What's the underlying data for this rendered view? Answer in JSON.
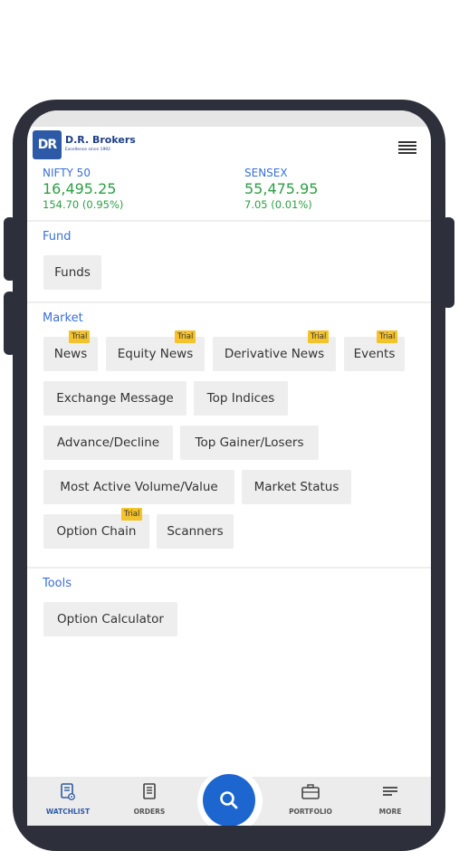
{
  "brand": {
    "logo_mark": "DR",
    "name": "D.R. Brokers",
    "tagline": "Excellence since 1992"
  },
  "indices": [
    {
      "name": "NIFTY 50",
      "value": "16,495.25",
      "change": "154.70 (0.95%)"
    },
    {
      "name": "SENSEX",
      "value": "55,475.95",
      "change": "7.05 (0.01%)"
    }
  ],
  "fund": {
    "title": "Fund",
    "items": [
      {
        "label": "Funds"
      }
    ]
  },
  "market": {
    "title": "Market",
    "badge_label": "Trial",
    "items": [
      {
        "label": "News",
        "trial": true
      },
      {
        "label": "Equity News",
        "trial": true
      },
      {
        "label": "Derivative News",
        "trial": true
      },
      {
        "label": "Events",
        "trial": true
      },
      {
        "label": "Exchange Message",
        "trial": false
      },
      {
        "label": "Top Indices",
        "trial": false
      },
      {
        "label": "Advance/Decline",
        "trial": false
      },
      {
        "label": "Top Gainer/Losers",
        "trial": false
      },
      {
        "label": "Most Active Volume/Value",
        "trial": false
      },
      {
        "label": "Market Status",
        "trial": false
      },
      {
        "label": "Option Chain",
        "trial": true
      },
      {
        "label": "Scanners",
        "trial": false
      }
    ]
  },
  "tools": {
    "title": "Tools",
    "items": [
      {
        "label": "Option Calculator"
      }
    ]
  },
  "bottom_nav": {
    "items": [
      {
        "label": "WATCHLIST",
        "icon": "watchlist-icon",
        "active": true
      },
      {
        "label": "ORDERS",
        "icon": "orders-icon",
        "active": false
      },
      {
        "label": "PORTFOLIO",
        "icon": "briefcase-icon",
        "active": false
      },
      {
        "label": "MORE",
        "icon": "more-icon",
        "active": false
      }
    ],
    "fab_icon": "search-icon"
  },
  "colors": {
    "accent": "#3a6fd8",
    "positive": "#2e9e46",
    "badge": "#f4c22b",
    "fab": "#1e66cf"
  }
}
